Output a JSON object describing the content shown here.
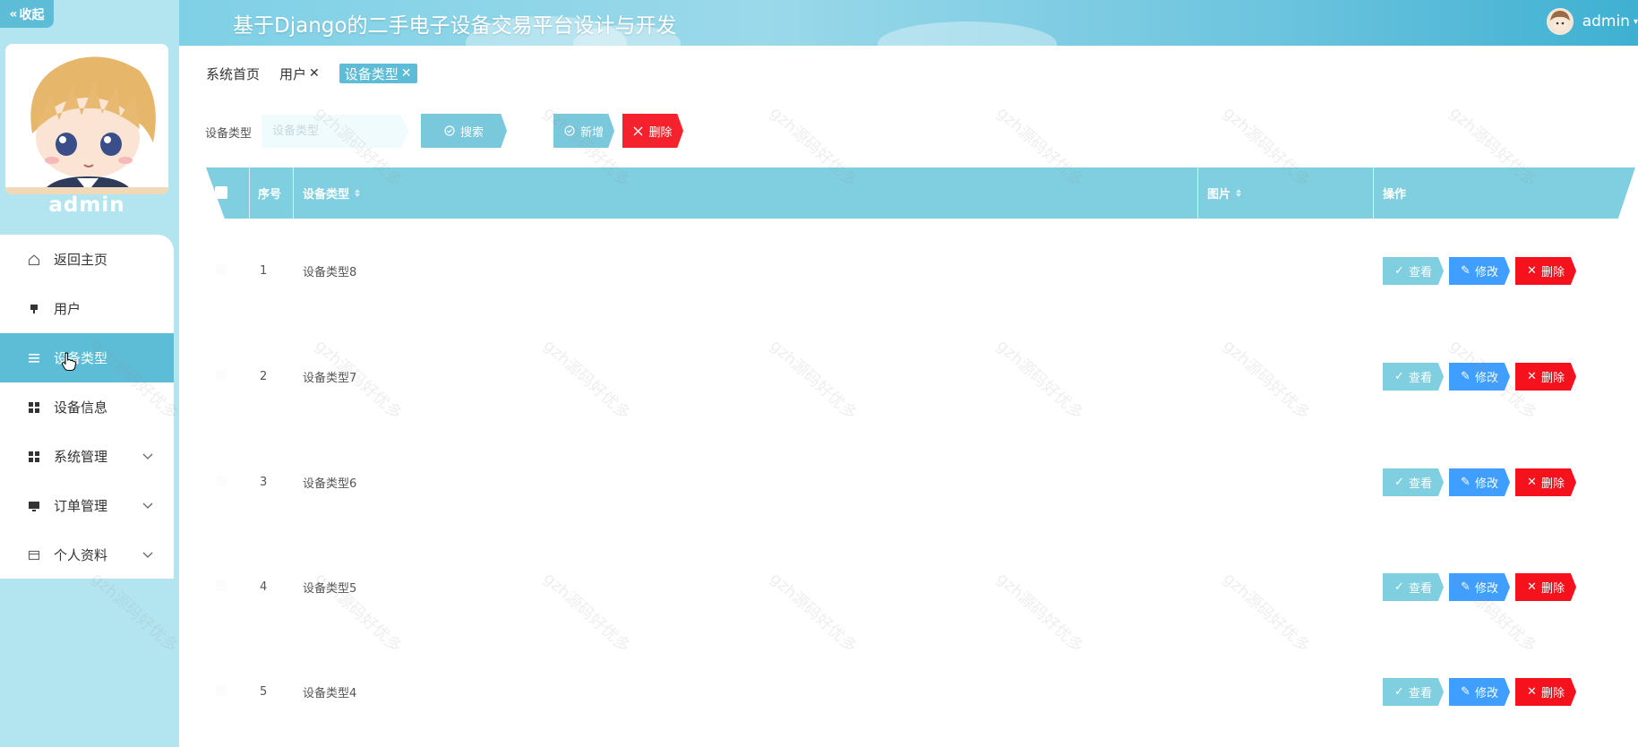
{
  "sidebar": {
    "collapse_label": "收起",
    "username": "admin",
    "items": [
      {
        "label": "返回主页",
        "icon": "home-icon",
        "expandable": false
      },
      {
        "label": "用户",
        "icon": "user-icon",
        "expandable": false
      },
      {
        "label": "设备类型",
        "icon": "list-icon",
        "expandable": false,
        "active": true
      },
      {
        "label": "设备信息",
        "icon": "grid-icon",
        "expandable": false
      },
      {
        "label": "系统管理",
        "icon": "grid-icon",
        "expandable": true
      },
      {
        "label": "订单管理",
        "icon": "monitor-icon",
        "expandable": true
      },
      {
        "label": "个人资料",
        "icon": "card-icon",
        "expandable": true
      }
    ]
  },
  "header": {
    "title": "基于Django的二手电子设备交易平台设计与开发",
    "username": "admin"
  },
  "tabs": [
    {
      "label": "系统首页",
      "closable": false
    },
    {
      "label": "用户",
      "closable": true
    },
    {
      "label": "设备类型",
      "closable": true,
      "active": true
    }
  ],
  "search": {
    "label": "设备类型",
    "placeholder": "设备类型",
    "search_button": "搜索",
    "add_button": "新增",
    "delete_button": "删除"
  },
  "table": {
    "columns": [
      "序号",
      "设备类型",
      "图片",
      "操作"
    ],
    "rows": [
      {
        "index": "1",
        "type": "设备类型8"
      },
      {
        "index": "2",
        "type": "设备类型7"
      },
      {
        "index": "3",
        "type": "设备类型6"
      },
      {
        "index": "4",
        "type": "设备类型5"
      },
      {
        "index": "5",
        "type": "设备类型4"
      }
    ],
    "row_actions": {
      "view": "查看",
      "edit": "修改",
      "delete": "删除"
    }
  },
  "watermark_text": "gzh源码好优多",
  "colors": {
    "primary": "#5dbcd6",
    "header_row": "#7fcfe0",
    "edit": "#409eff",
    "danger": "#f5121c",
    "sidebar_bg": "#b3e5f0"
  }
}
